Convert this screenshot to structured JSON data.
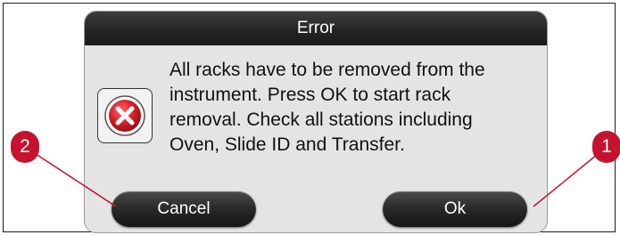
{
  "dialog": {
    "title": "Error",
    "message": "All racks have to be removed from the\ninstrument. Press OK to start rack\nremoval. Check all stations including\nOven, Slide ID and Transfer.",
    "icon": "error-x-icon",
    "buttons": {
      "cancel_label": "Cancel",
      "ok_label": "Ok"
    }
  },
  "callouts": {
    "cancel_marker": "2",
    "ok_marker": "1"
  },
  "colors": {
    "header": "#242424",
    "button": "#262626",
    "callout": "#c4122f",
    "error_icon": "#d21f2a"
  }
}
